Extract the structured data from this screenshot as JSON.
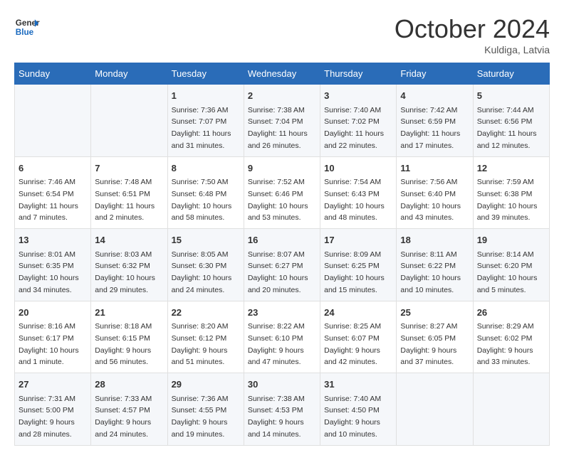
{
  "header": {
    "logo_line1": "General",
    "logo_line2": "Blue",
    "month": "October 2024",
    "location": "Kuldiga, Latvia"
  },
  "weekdays": [
    "Sunday",
    "Monday",
    "Tuesday",
    "Wednesday",
    "Thursday",
    "Friday",
    "Saturday"
  ],
  "weeks": [
    [
      null,
      null,
      {
        "day": "1",
        "sunrise": "Sunrise: 7:36 AM",
        "sunset": "Sunset: 7:07 PM",
        "daylight": "Daylight: 11 hours and 31 minutes."
      },
      {
        "day": "2",
        "sunrise": "Sunrise: 7:38 AM",
        "sunset": "Sunset: 7:04 PM",
        "daylight": "Daylight: 11 hours and 26 minutes."
      },
      {
        "day": "3",
        "sunrise": "Sunrise: 7:40 AM",
        "sunset": "Sunset: 7:02 PM",
        "daylight": "Daylight: 11 hours and 22 minutes."
      },
      {
        "day": "4",
        "sunrise": "Sunrise: 7:42 AM",
        "sunset": "Sunset: 6:59 PM",
        "daylight": "Daylight: 11 hours and 17 minutes."
      },
      {
        "day": "5",
        "sunrise": "Sunrise: 7:44 AM",
        "sunset": "Sunset: 6:56 PM",
        "daylight": "Daylight: 11 hours and 12 minutes."
      }
    ],
    [
      {
        "day": "6",
        "sunrise": "Sunrise: 7:46 AM",
        "sunset": "Sunset: 6:54 PM",
        "daylight": "Daylight: 11 hours and 7 minutes."
      },
      {
        "day": "7",
        "sunrise": "Sunrise: 7:48 AM",
        "sunset": "Sunset: 6:51 PM",
        "daylight": "Daylight: 11 hours and 2 minutes."
      },
      {
        "day": "8",
        "sunrise": "Sunrise: 7:50 AM",
        "sunset": "Sunset: 6:48 PM",
        "daylight": "Daylight: 10 hours and 58 minutes."
      },
      {
        "day": "9",
        "sunrise": "Sunrise: 7:52 AM",
        "sunset": "Sunset: 6:46 PM",
        "daylight": "Daylight: 10 hours and 53 minutes."
      },
      {
        "day": "10",
        "sunrise": "Sunrise: 7:54 AM",
        "sunset": "Sunset: 6:43 PM",
        "daylight": "Daylight: 10 hours and 48 minutes."
      },
      {
        "day": "11",
        "sunrise": "Sunrise: 7:56 AM",
        "sunset": "Sunset: 6:40 PM",
        "daylight": "Daylight: 10 hours and 43 minutes."
      },
      {
        "day": "12",
        "sunrise": "Sunrise: 7:59 AM",
        "sunset": "Sunset: 6:38 PM",
        "daylight": "Daylight: 10 hours and 39 minutes."
      }
    ],
    [
      {
        "day": "13",
        "sunrise": "Sunrise: 8:01 AM",
        "sunset": "Sunset: 6:35 PM",
        "daylight": "Daylight: 10 hours and 34 minutes."
      },
      {
        "day": "14",
        "sunrise": "Sunrise: 8:03 AM",
        "sunset": "Sunset: 6:32 PM",
        "daylight": "Daylight: 10 hours and 29 minutes."
      },
      {
        "day": "15",
        "sunrise": "Sunrise: 8:05 AM",
        "sunset": "Sunset: 6:30 PM",
        "daylight": "Daylight: 10 hours and 24 minutes."
      },
      {
        "day": "16",
        "sunrise": "Sunrise: 8:07 AM",
        "sunset": "Sunset: 6:27 PM",
        "daylight": "Daylight: 10 hours and 20 minutes."
      },
      {
        "day": "17",
        "sunrise": "Sunrise: 8:09 AM",
        "sunset": "Sunset: 6:25 PM",
        "daylight": "Daylight: 10 hours and 15 minutes."
      },
      {
        "day": "18",
        "sunrise": "Sunrise: 8:11 AM",
        "sunset": "Sunset: 6:22 PM",
        "daylight": "Daylight: 10 hours and 10 minutes."
      },
      {
        "day": "19",
        "sunrise": "Sunrise: 8:14 AM",
        "sunset": "Sunset: 6:20 PM",
        "daylight": "Daylight: 10 hours and 5 minutes."
      }
    ],
    [
      {
        "day": "20",
        "sunrise": "Sunrise: 8:16 AM",
        "sunset": "Sunset: 6:17 PM",
        "daylight": "Daylight: 10 hours and 1 minute."
      },
      {
        "day": "21",
        "sunrise": "Sunrise: 8:18 AM",
        "sunset": "Sunset: 6:15 PM",
        "daylight": "Daylight: 9 hours and 56 minutes."
      },
      {
        "day": "22",
        "sunrise": "Sunrise: 8:20 AM",
        "sunset": "Sunset: 6:12 PM",
        "daylight": "Daylight: 9 hours and 51 minutes."
      },
      {
        "day": "23",
        "sunrise": "Sunrise: 8:22 AM",
        "sunset": "Sunset: 6:10 PM",
        "daylight": "Daylight: 9 hours and 47 minutes."
      },
      {
        "day": "24",
        "sunrise": "Sunrise: 8:25 AM",
        "sunset": "Sunset: 6:07 PM",
        "daylight": "Daylight: 9 hours and 42 minutes."
      },
      {
        "day": "25",
        "sunrise": "Sunrise: 8:27 AM",
        "sunset": "Sunset: 6:05 PM",
        "daylight": "Daylight: 9 hours and 37 minutes."
      },
      {
        "day": "26",
        "sunrise": "Sunrise: 8:29 AM",
        "sunset": "Sunset: 6:02 PM",
        "daylight": "Daylight: 9 hours and 33 minutes."
      }
    ],
    [
      {
        "day": "27",
        "sunrise": "Sunrise: 7:31 AM",
        "sunset": "Sunset: 5:00 PM",
        "daylight": "Daylight: 9 hours and 28 minutes."
      },
      {
        "day": "28",
        "sunrise": "Sunrise: 7:33 AM",
        "sunset": "Sunset: 4:57 PM",
        "daylight": "Daylight: 9 hours and 24 minutes."
      },
      {
        "day": "29",
        "sunrise": "Sunrise: 7:36 AM",
        "sunset": "Sunset: 4:55 PM",
        "daylight": "Daylight: 9 hours and 19 minutes."
      },
      {
        "day": "30",
        "sunrise": "Sunrise: 7:38 AM",
        "sunset": "Sunset: 4:53 PM",
        "daylight": "Daylight: 9 hours and 14 minutes."
      },
      {
        "day": "31",
        "sunrise": "Sunrise: 7:40 AM",
        "sunset": "Sunset: 4:50 PM",
        "daylight": "Daylight: 9 hours and 10 minutes."
      },
      null,
      null
    ]
  ]
}
